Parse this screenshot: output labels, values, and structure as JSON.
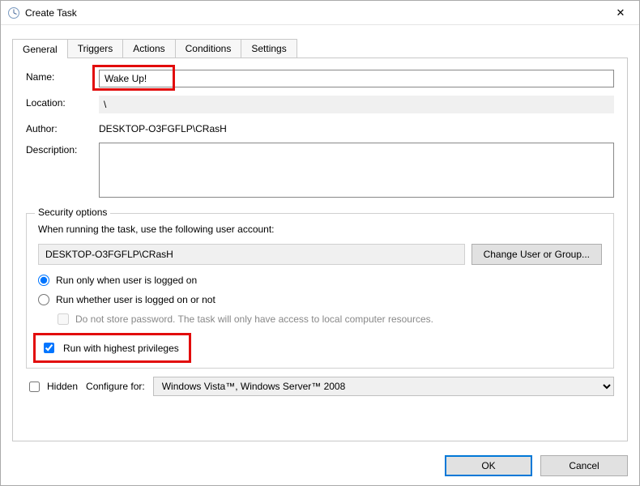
{
  "window": {
    "title": "Create Task",
    "close_icon": "✕"
  },
  "tabs": {
    "general": "General",
    "triggers": "Triggers",
    "actions": "Actions",
    "conditions": "Conditions",
    "settings": "Settings"
  },
  "general": {
    "name_label": "Name:",
    "name_value": "Wake Up!",
    "location_label": "Location:",
    "location_value": "\\",
    "author_label": "Author:",
    "author_value": "DESKTOP-O3FGFLP\\CRasH",
    "description_label": "Description:",
    "description_value": ""
  },
  "security": {
    "legend": "Security options",
    "prompt": "When running the task, use the following user account:",
    "user": "DESKTOP-O3FGFLP\\CRasH",
    "change_user_btn": "Change User or Group...",
    "run_logged_on": "Run only when user is logged on",
    "run_whether": "Run whether user is logged on or not",
    "do_not_store": "Do not store password.  The task will only have access to local computer resources.",
    "highest_priv": "Run with highest privileges"
  },
  "bottom": {
    "hidden_label": "Hidden",
    "configure_label": "Configure for:",
    "configure_value": "Windows Vista™, Windows Server™ 2008"
  },
  "footer": {
    "ok": "OK",
    "cancel": "Cancel"
  }
}
